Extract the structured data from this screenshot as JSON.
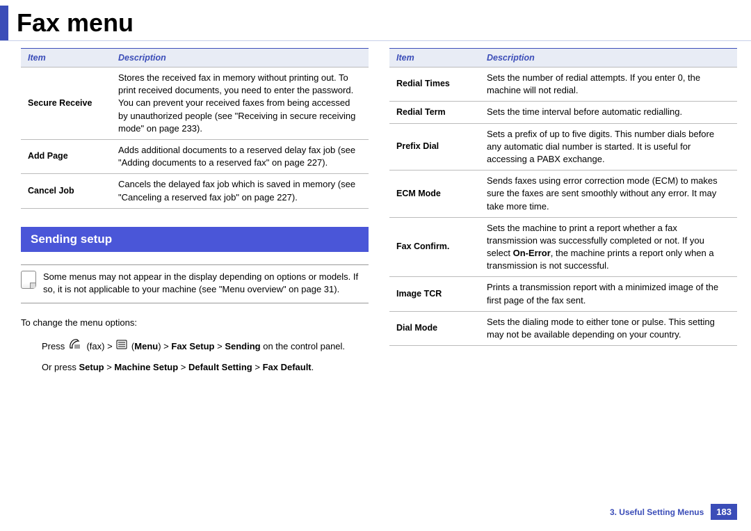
{
  "title": "Fax menu",
  "table1": {
    "headers": [
      "Item",
      "Description"
    ],
    "rows": [
      {
        "item": "Secure Receive",
        "desc": "Stores the received fax in memory without printing out. To print received documents, you need to enter the password. You can prevent your received faxes from being accessed by unauthorized people (see \"Receiving in secure receiving mode\" on page 233)."
      },
      {
        "item": "Add Page",
        "desc": "Adds additional documents to a reserved delay fax job (see \"Adding documents to a reserved fax\" on page 227)."
      },
      {
        "item": "Cancel Job",
        "desc": "Cancels the delayed fax job which is saved in memory (see \"Canceling a reserved fax job\" on page 227)."
      }
    ]
  },
  "section_header": "Sending setup",
  "note": "Some menus may not appear in the display depending on options or models. If so, it is not applicable to your machine (see \"Menu overview\" on page 31).",
  "instr_intro": "To change the menu options:",
  "instr1": {
    "prefix": "Press ",
    "fax_label": " (fax) > ",
    "menu_parens": " (",
    "menu": "Menu",
    "path1": ") > ",
    "b1": "Fax Setup",
    "sep": " > ",
    "b2": "Sending",
    "suffix": " on the control panel."
  },
  "instr2": {
    "prefix": "Or press ",
    "b1": "Setup",
    "sep": " > ",
    "b2": "Machine Setup",
    "b3": "Default Setting",
    "b4": "Fax Default",
    "suffix": "."
  },
  "table2": {
    "headers": [
      "Item",
      "Description"
    ],
    "rows": [
      {
        "item": "Redial Times",
        "desc": "Sets the number of redial attempts. If you enter 0, the machine will not redial."
      },
      {
        "item": "Redial Term",
        "desc": "Sets the time interval before automatic redialling."
      },
      {
        "item": "Prefix Dial",
        "desc": "Sets a prefix of up to five digits. This number dials before any automatic dial number is started. It is useful for accessing a PABX exchange."
      },
      {
        "item": "ECM Mode",
        "desc": "Sends faxes using error correction mode (ECM) to makes sure the faxes are sent smoothly without any error. It may take more time."
      },
      {
        "item": "Fax Confirm.",
        "desc_html": "Sets the machine to print a report whether a fax transmission was successfully completed or not. If you select <b>On-Error</b>, the machine prints a report only when a transmission is not successful."
      },
      {
        "item": "Image TCR",
        "desc": "Prints a transmission report with a minimized image of the first page of the fax sent."
      },
      {
        "item": "Dial Mode",
        "desc": "Sets the dialing mode to either tone or pulse. This setting may not be available depending on your country."
      }
    ]
  },
  "footer": {
    "chapter": "3.  Useful Setting Menus",
    "page": "183"
  }
}
